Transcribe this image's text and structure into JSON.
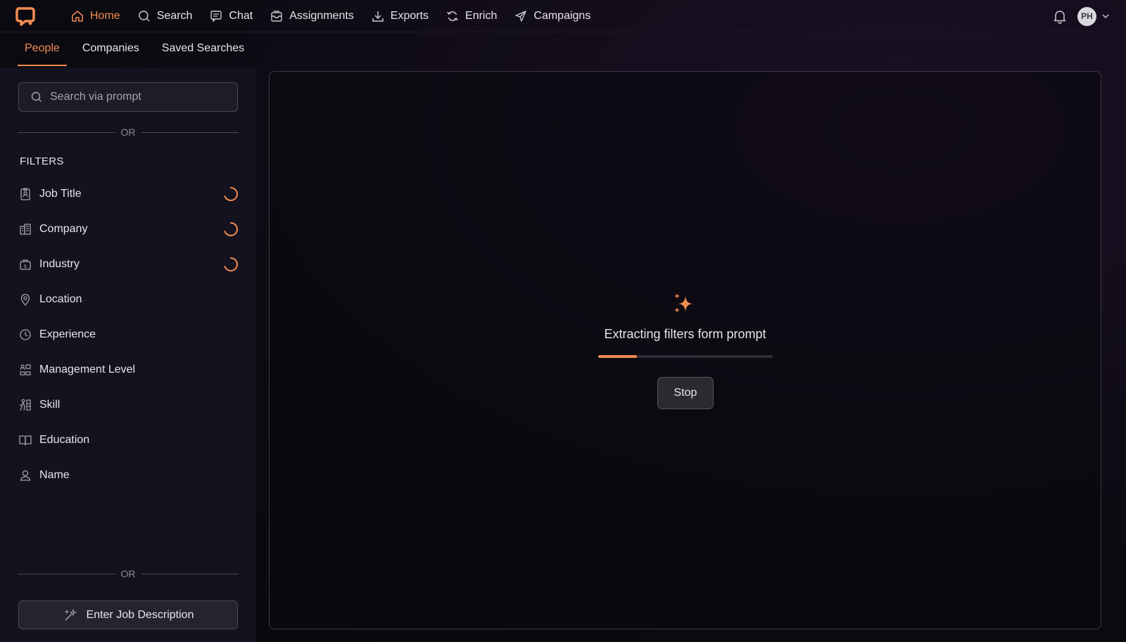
{
  "app": {
    "brand_color": "#f28b52",
    "logo_icon": "brand-logo-icon"
  },
  "nav": {
    "items": [
      {
        "label": "Home",
        "icon": "home-icon",
        "active": true
      },
      {
        "label": "Search",
        "icon": "search-icon",
        "active": false
      },
      {
        "label": "Chat",
        "icon": "chat-icon",
        "active": false
      },
      {
        "label": "Assignments",
        "icon": "inbox-icon",
        "active": false
      },
      {
        "label": "Exports",
        "icon": "download-icon",
        "active": false
      },
      {
        "label": "Enrich",
        "icon": "refresh-icon",
        "active": false
      },
      {
        "label": "Campaigns",
        "icon": "send-icon",
        "active": false
      }
    ],
    "user_initials": "PH"
  },
  "subtabs": [
    {
      "label": "People",
      "active": true
    },
    {
      "label": "Companies",
      "active": false
    },
    {
      "label": "Saved Searches",
      "active": false
    }
  ],
  "sidebar": {
    "search_placeholder": "Search via prompt",
    "or_text": "OR",
    "filters_title": "FILTERS",
    "filters": [
      {
        "label": "Job Title",
        "icon": "id-badge-icon",
        "loading": true
      },
      {
        "label": "Company",
        "icon": "building-icon",
        "loading": true
      },
      {
        "label": "Industry",
        "icon": "briefcase-icon",
        "loading": true
      },
      {
        "label": "Location",
        "icon": "map-pin-icon",
        "loading": false
      },
      {
        "label": "Experience",
        "icon": "clock-icon",
        "loading": false
      },
      {
        "label": "Management Level",
        "icon": "org-chart-icon",
        "loading": false
      },
      {
        "label": "Skill",
        "icon": "skill-icon",
        "loading": false
      },
      {
        "label": "Education",
        "icon": "book-icon",
        "loading": false
      },
      {
        "label": "Name",
        "icon": "user-icon",
        "loading": false
      }
    ],
    "or_text_bottom": "OR",
    "job_description_label": "Enter Job Description"
  },
  "main": {
    "status_text": "Extracting filters form prompt",
    "progress_fraction": 0.22,
    "stop_label": "Stop"
  }
}
